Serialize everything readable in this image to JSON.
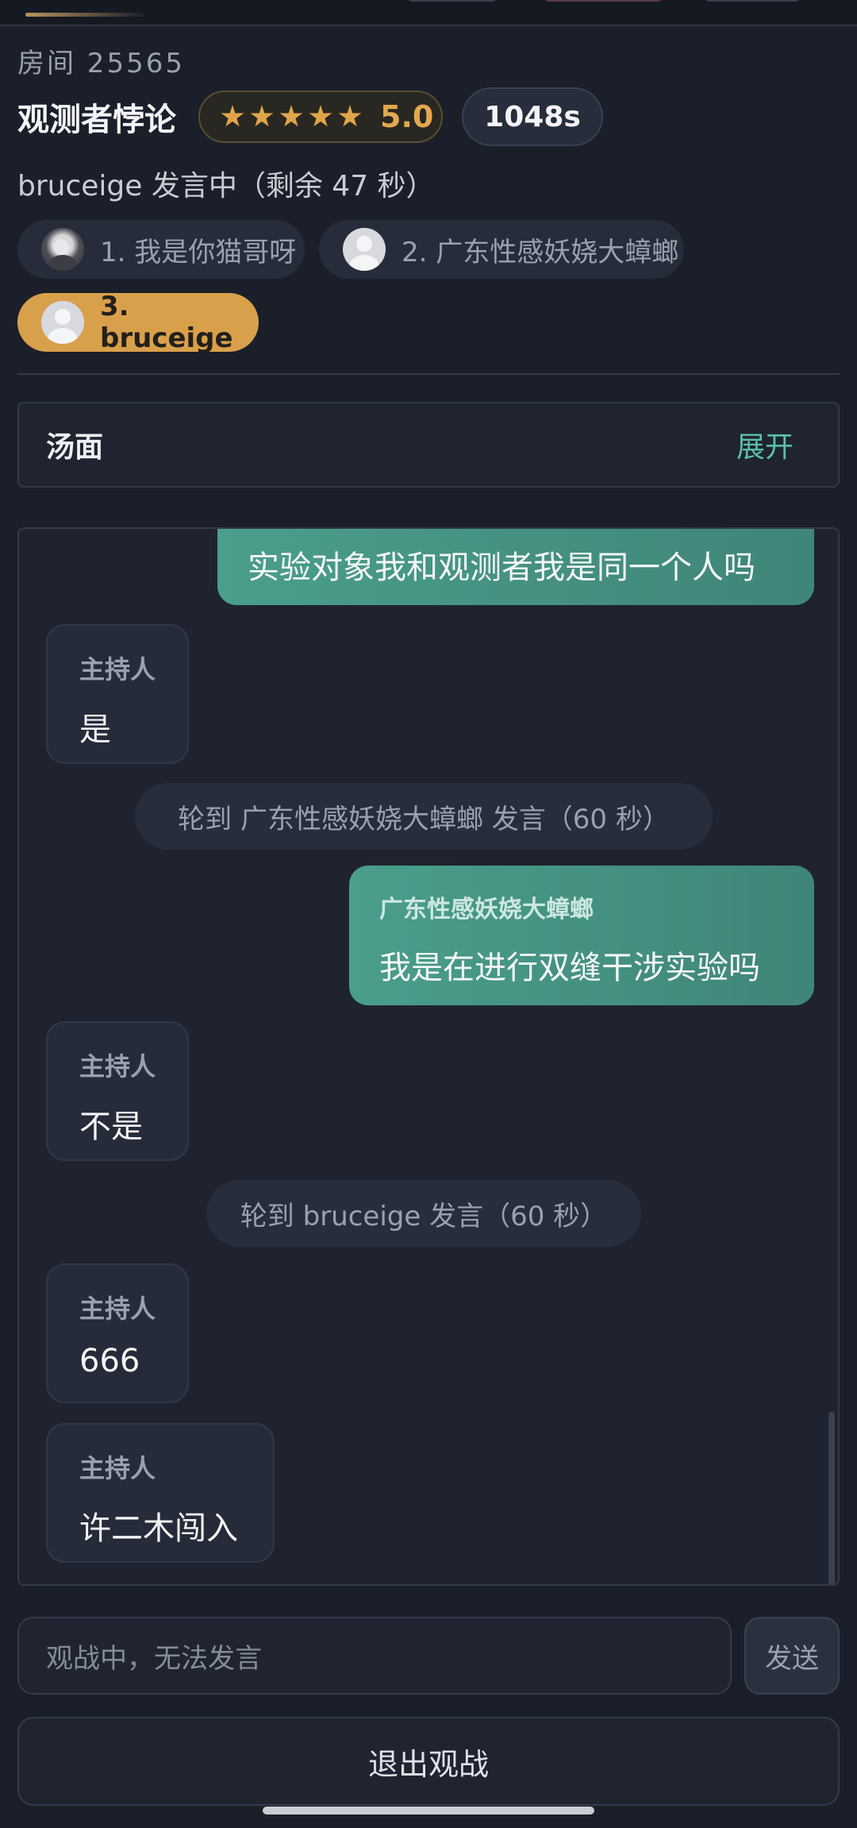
{
  "header": {
    "room": "房间 25565",
    "title": "观测者悖论",
    "rating": "5.0",
    "stars_filled": 5,
    "stars_total": 5,
    "timer": "1048s",
    "speaking_status": "bruceige 发言中（剩余 47 秒）"
  },
  "players": [
    {
      "label": "1. 我是你猫哥呀",
      "avatar": "photo-avatar"
    },
    {
      "label": "2. 广东性感妖娆大蟑螂",
      "avatar": "default-avatar"
    },
    {
      "label": "3. bruceige",
      "avatar": "default-avatar",
      "active": true
    }
  ],
  "soup": {
    "title": "汤面",
    "expand_label": "展开"
  },
  "messages": [
    {
      "type": "self",
      "text": "实验对象我和观测者我是同一个人吗"
    },
    {
      "type": "host",
      "name": "主持人",
      "text": "是"
    },
    {
      "type": "system",
      "text": "轮到 广东性感妖娆大蟑螂 发言（60 秒）"
    },
    {
      "type": "player",
      "name": "广东性感妖娆大蟑螂",
      "text": "我是在进行双缝干涉实验吗"
    },
    {
      "type": "host",
      "name": "主持人",
      "text": "不是"
    },
    {
      "type": "system",
      "text": "轮到 bruceige 发言（60 秒）"
    },
    {
      "type": "host",
      "name": "主持人",
      "text": "666"
    },
    {
      "type": "host",
      "name": "主持人",
      "text": "许二木闯入"
    }
  ],
  "composer": {
    "placeholder": "观战中，无法发言",
    "send_label": "发送"
  },
  "exit_label": "退出观战",
  "colors": {
    "background": "#1b1f29",
    "accent_gold": "#d9a04c",
    "accent_teal": "#4a9e8c",
    "link_teal": "#5bbfa8"
  }
}
